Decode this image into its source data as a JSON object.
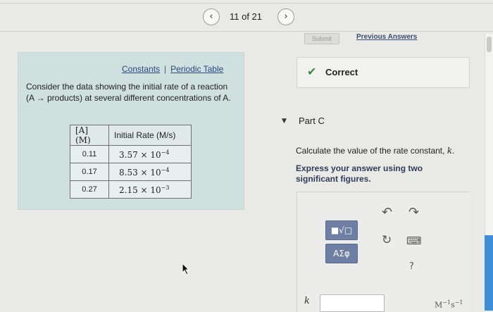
{
  "pager": {
    "prev_icon": "‹",
    "count": "11 of 21",
    "next_icon": "›"
  },
  "header": {
    "submit_label": "Submit",
    "previous_answers": "Previous Answers"
  },
  "left": {
    "constants_link": "Constants",
    "separator": "|",
    "periodic_table_link": "Periodic Table",
    "problem_text": "Consider the data showing the initial rate of a reaction (A → products) at several different concentrations of A.",
    "table": {
      "headers": [
        "[A] (M)",
        "Initial Rate (M/s)"
      ],
      "rows": [
        {
          "conc": "0.11",
          "rate": "3.57 × 10",
          "exp": "−4"
        },
        {
          "conc": "0.17",
          "rate": "8.53 × 10",
          "exp": "−4"
        },
        {
          "conc": "0.27",
          "rate": "2.15 × 10",
          "exp": "−3"
        }
      ]
    }
  },
  "feedback": {
    "status": "Correct",
    "icon": "checkmark-icon"
  },
  "part": {
    "caret": "▼",
    "label": "Part C",
    "question_prefix": "Calculate the value of the rate constant, ",
    "question_var": "k",
    "question_suffix": ".",
    "instruction": "Express your answer using two significant figures."
  },
  "toolbar": {
    "template_label": "■√□",
    "greek_label": "ΑΣφ",
    "undo_icon": "↶",
    "redo_icon": "↷",
    "reset_icon": "↻",
    "keyboard_icon": "⌨",
    "help_icon": "?"
  },
  "answer": {
    "variable": "k",
    "value": "",
    "units_base": "M",
    "units_exp1": "−1",
    "units_mid": "s",
    "units_exp2": "−1"
  },
  "colors": {
    "panel_bg": "#cfe0df",
    "link": "#26487d",
    "correct_check": "#3a8a3a",
    "toolbar_button": "#6e7fa3",
    "scroll_accent": "#3f8fd8"
  }
}
